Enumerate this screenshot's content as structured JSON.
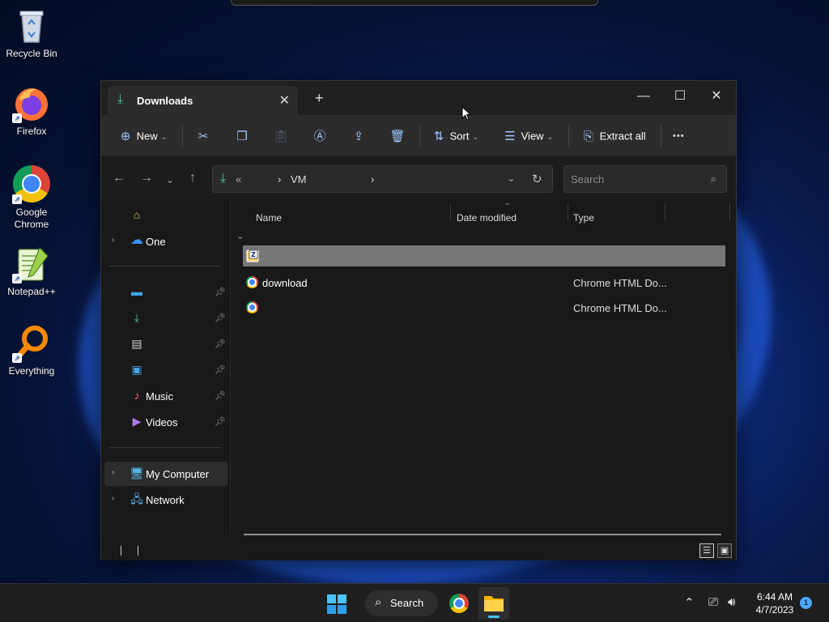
{
  "desktop": {
    "icons": [
      {
        "label": "Recycle Bin",
        "icon": "recycle-bin-icon"
      },
      {
        "label": "Firefox",
        "icon": "firefox-icon"
      },
      {
        "label": "Google Chrome",
        "icon": "chrome-icon"
      },
      {
        "label": "Notepad++",
        "icon": "notepad-plus-plus-icon"
      },
      {
        "label": "Everything",
        "icon": "everything-search-icon"
      }
    ]
  },
  "window": {
    "tab_title": "Downloads",
    "new_tab": "+",
    "controls": {
      "minimize": "—",
      "maximize": "☐",
      "close": "✕"
    }
  },
  "toolbar": {
    "new_label": "New",
    "sort_label": "Sort",
    "view_label": "View",
    "extract_label": "Extract all",
    "more": "•••"
  },
  "address": {
    "overflow": "«",
    "segment": "VM",
    "separator": "›"
  },
  "search": {
    "placeholder": "Search"
  },
  "sidebar": {
    "items": [
      {
        "label": ""
      },
      {
        "label": "One"
      },
      {
        "label": ""
      },
      {
        "label": ""
      },
      {
        "label": ""
      },
      {
        "label": ""
      },
      {
        "label": "Music"
      },
      {
        "label": "Videos"
      },
      {
        "label": "My Computer"
      },
      {
        "label": "Network"
      }
    ]
  },
  "columns": {
    "name": "Name",
    "date": "Date modified",
    "type": "Type"
  },
  "files": [
    {
      "name": "",
      "type": "",
      "icon": "archive-icon",
      "selected": true
    },
    {
      "name": "download",
      "type": "Chrome HTML Do...",
      "icon": "chrome-icon",
      "selected": false
    },
    {
      "name": "",
      "type": "Chrome HTML Do...",
      "icon": "chrome-icon",
      "selected": false
    }
  ],
  "taskbar": {
    "search_label": "Search",
    "time": "6:44 AM",
    "date": "4/7/2023",
    "notification_count": "1"
  },
  "colors": {
    "accent": "#4cc2a0",
    "selection": "#777777",
    "window_bg": "#191919"
  }
}
